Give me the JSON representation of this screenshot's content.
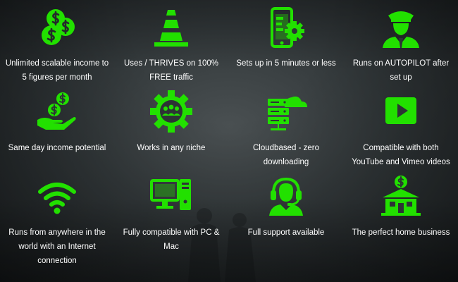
{
  "accent": "#22e000",
  "features": [
    {
      "icon": "money-coins-icon",
      "label": "Unlimited scalable income to 5 figures per month"
    },
    {
      "icon": "traffic-cone-icon",
      "label": "Uses / THRIVES on 100% FREE traffic"
    },
    {
      "icon": "phone-gear-icon",
      "label": "Sets up in 5 minutes or less"
    },
    {
      "icon": "pilot-icon",
      "label": "Runs on AUTOPILOT after set up"
    },
    {
      "icon": "hand-coins-icon",
      "label": "Same day income potential"
    },
    {
      "icon": "gear-people-icon",
      "label": "Works in any niche"
    },
    {
      "icon": "cloud-server-icon",
      "label": "Cloudbased - zero downloading"
    },
    {
      "icon": "play-button-icon",
      "label": "Compatible with both YouTube and Vimeo videos"
    },
    {
      "icon": "wifi-icon",
      "label": "Runs from anywhere in the world with an Internet connection"
    },
    {
      "icon": "desktop-pc-icon",
      "label": "Fully compatible with PC & Mac"
    },
    {
      "icon": "headset-support-icon",
      "label": "Full support available"
    },
    {
      "icon": "home-business-icon",
      "label": "The perfect home business"
    }
  ]
}
